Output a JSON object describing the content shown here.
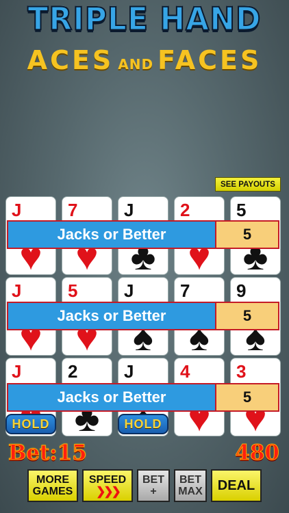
{
  "title": {
    "main": "TRIPLE HAND",
    "sub_left": "ACES",
    "sub_and": "AND",
    "sub_right": "FACES"
  },
  "see_payouts_label": "SEE PAYOUTS",
  "hands": [
    {
      "label": "Jacks or Better",
      "payout": "5",
      "cards": [
        {
          "rank": "J",
          "suit": "♥",
          "color": "#e0121a"
        },
        {
          "rank": "7",
          "suit": "♥",
          "color": "#e0121a"
        },
        {
          "rank": "J",
          "suit": "♣",
          "color": "#111111"
        },
        {
          "rank": "2",
          "suit": "♥",
          "color": "#e0121a"
        },
        {
          "rank": "5",
          "suit": "♣",
          "color": "#111111"
        }
      ]
    },
    {
      "label": "Jacks or Better",
      "payout": "5",
      "cards": [
        {
          "rank": "J",
          "suit": "♥",
          "color": "#e0121a"
        },
        {
          "rank": "5",
          "suit": "♥",
          "color": "#e0121a"
        },
        {
          "rank": "J",
          "suit": "♠",
          "color": "#111111"
        },
        {
          "rank": "7",
          "suit": "♠",
          "color": "#111111"
        },
        {
          "rank": "9",
          "suit": "♠",
          "color": "#111111"
        }
      ]
    },
    {
      "label": "Jacks or Better",
      "payout": "5",
      "cards": [
        {
          "rank": "J",
          "suit": "♥",
          "color": "#e0121a"
        },
        {
          "rank": "2",
          "suit": "♣",
          "color": "#111111"
        },
        {
          "rank": "J",
          "suit": "♠",
          "color": "#111111"
        },
        {
          "rank": "4",
          "suit": "♥",
          "color": "#e0121a"
        },
        {
          "rank": "3",
          "suit": "♥",
          "color": "#e0121a"
        }
      ]
    }
  ],
  "hold_label": "HOLD",
  "held_positions": [
    0,
    2
  ],
  "bet_label": "Bet:15",
  "credits": "480",
  "buttons": {
    "more_games_line1": "MORE",
    "more_games_line2": "GAMES",
    "speed_label": "SPEED",
    "speed_icon": "chevrons-right-icon",
    "bet_plus_line1": "BET",
    "bet_plus_line2": "+",
    "bet_max_line1": "BET",
    "bet_max_line2": "MAX",
    "deal_label": "DEAL"
  }
}
